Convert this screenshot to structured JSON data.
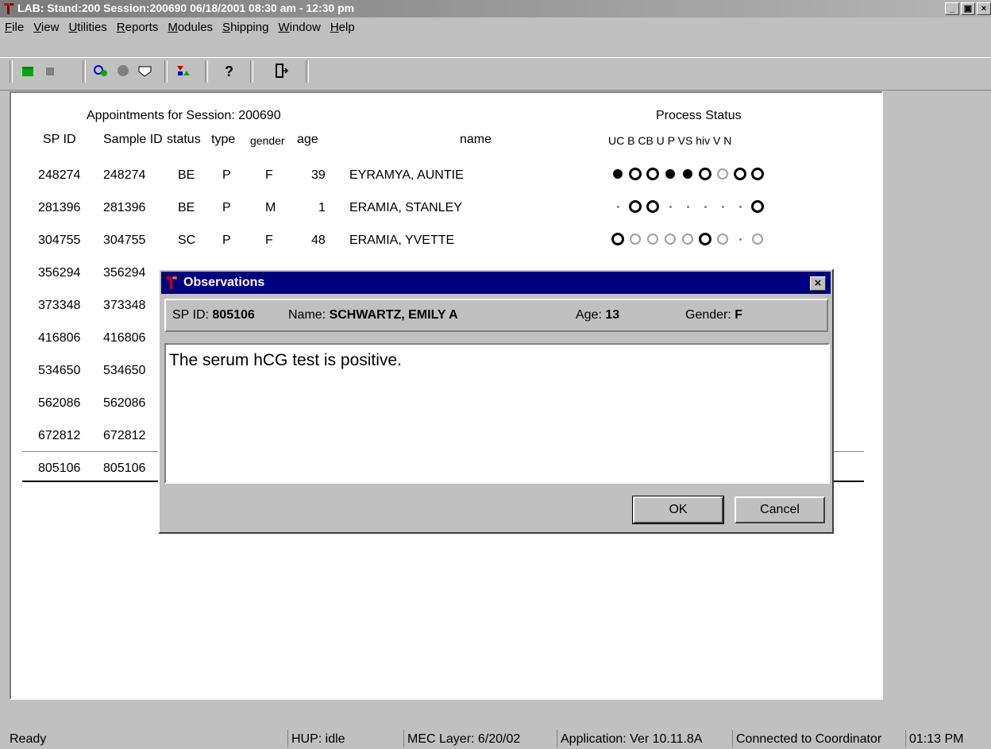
{
  "window": {
    "title": "LAB: Stand:200 Session:200690 06/18/2001 08:30 am - 12:30 pm",
    "min": "_",
    "max": "▣",
    "close": "×"
  },
  "menu": [
    {
      "label": "File",
      "u": "F",
      "rest": "ile"
    },
    {
      "label": "View",
      "u": "V",
      "rest": "iew"
    },
    {
      "label": "Utilities",
      "u": "U",
      "rest": "tilities"
    },
    {
      "label": "Reports",
      "u": "R",
      "rest": "eports"
    },
    {
      "label": "Modules",
      "u": "M",
      "rest": "odules"
    },
    {
      "label": "Shipping",
      "u": "S",
      "rest": "hipping"
    },
    {
      "label": "Window",
      "u": "W",
      "rest": "indow"
    },
    {
      "label": "Help",
      "u": "H",
      "rest": "elp"
    }
  ],
  "main": {
    "session_title": "Appointments for Session: 200690",
    "process_title": "Process Status",
    "columns": {
      "spid": "SP ID",
      "sample": "Sample ID",
      "status": "status",
      "type": "type",
      "gender": "gender",
      "age": "age",
      "name": "name",
      "process": "UC  B  CB  U   P  VS hiv  V  N"
    },
    "rows": [
      {
        "spid": "248274",
        "sample": "248274",
        "status": "BE",
        "type": "P",
        "gender": "F",
        "age": "39",
        "name": "EYRAMYA, AUNTIE",
        "dots": [
          "filled",
          "open",
          "open",
          "filled",
          "filled",
          "open",
          "gray",
          "open",
          "open"
        ]
      },
      {
        "spid": "281396",
        "sample": "281396",
        "status": "BE",
        "type": "P",
        "gender": "M",
        "age": "1",
        "name": "ERAMIA, STANLEY",
        "dots": [
          "small",
          "open",
          "open",
          "small",
          "small",
          "small",
          "small",
          "small",
          "open"
        ]
      },
      {
        "spid": "304755",
        "sample": "304755",
        "status": "SC",
        "type": "P",
        "gender": "F",
        "age": "48",
        "name": "ERAMIA, YVETTE",
        "dots": [
          "open",
          "gray",
          "gray",
          "gray",
          "gray",
          "open",
          "gray",
          "small",
          "gray"
        ]
      },
      {
        "spid": "356294",
        "sample": "356294"
      },
      {
        "spid": "373348",
        "sample": "373348"
      },
      {
        "spid": "416806",
        "sample": "416806"
      },
      {
        "spid": "534650",
        "sample": "534650"
      },
      {
        "spid": "562086",
        "sample": "562086"
      },
      {
        "spid": "672812",
        "sample": "672812"
      },
      {
        "spid": "805106",
        "sample": "805106"
      }
    ]
  },
  "dialog": {
    "title": "Observations",
    "spid_label": "SP ID:",
    "spid": "805106",
    "name_label": "Name:",
    "name": "SCHWARTZ, EMILY A",
    "age_label": "Age:",
    "age": "13",
    "gender_label": "Gender:",
    "gender": "F",
    "text": "The serum hCG test is positive.",
    "ok": "OK",
    "cancel": "Cancel"
  },
  "status": {
    "ready": "Ready",
    "hup": "HUP: idle",
    "mec": "MEC Layer: 6/20/02",
    "app": "Application: Ver 10.11.8A",
    "conn": "Connected to Coordinator",
    "time": "01:13 PM"
  },
  "icons": [
    "new-icon",
    "edit-icon",
    "find-icon",
    "stop-icon",
    "tag-icon",
    "swap-icon",
    "help-icon",
    "exit-icon"
  ]
}
